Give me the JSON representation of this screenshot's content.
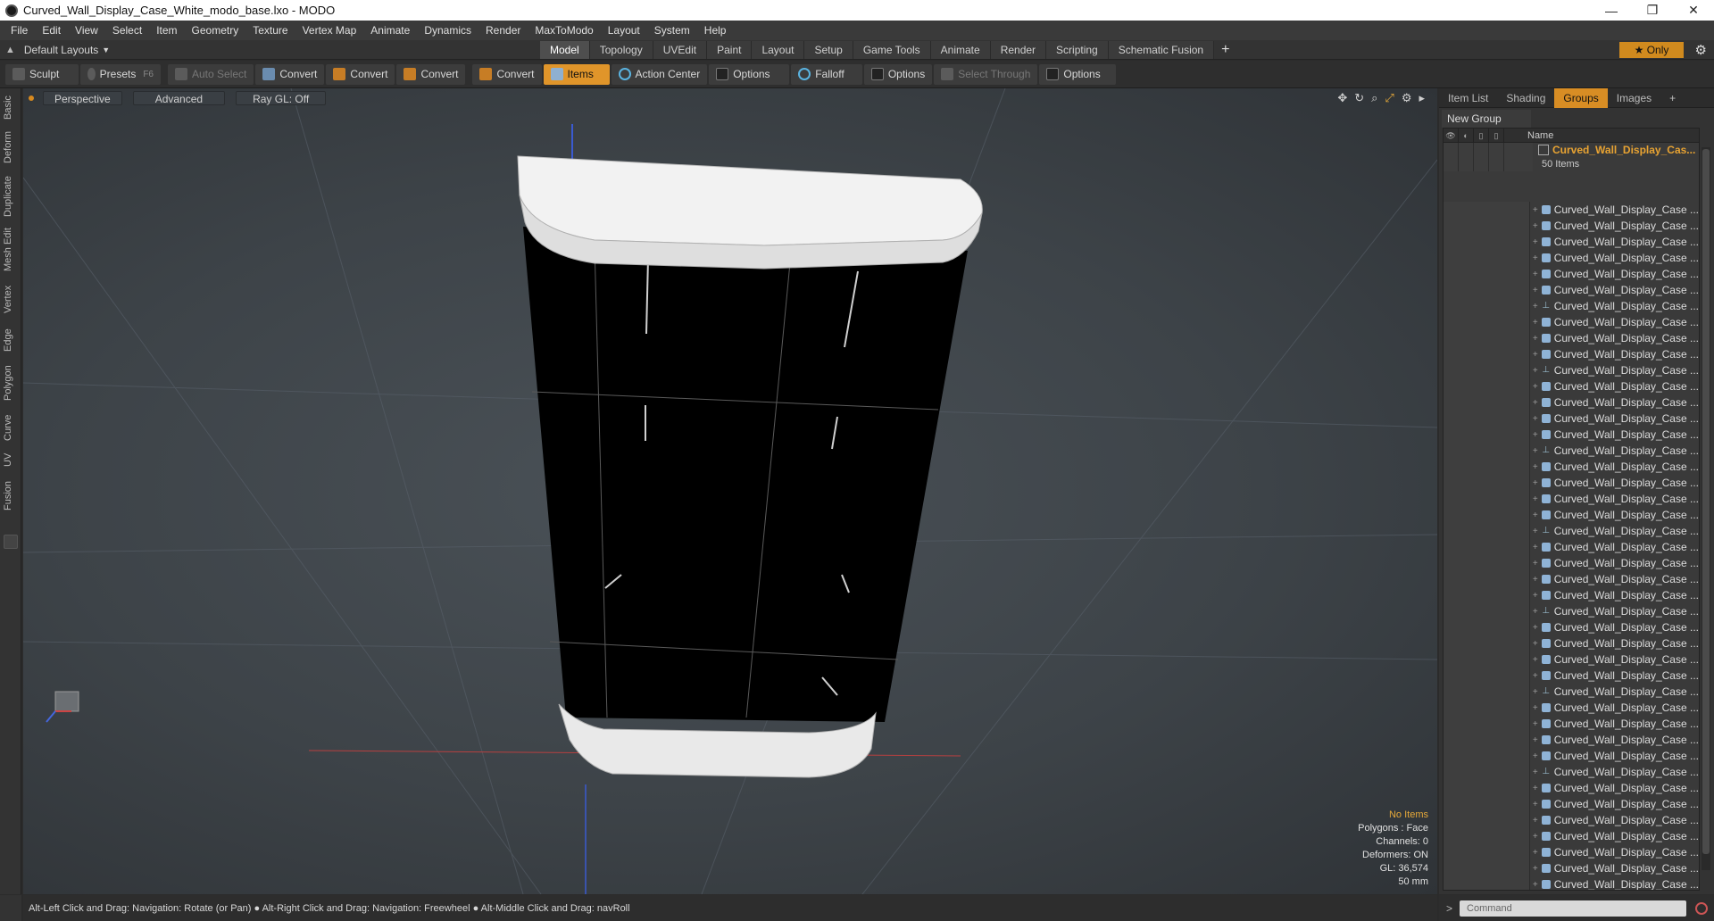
{
  "window": {
    "title": "Curved_Wall_Display_Case_White_modo_base.lxo - MODO",
    "minimize": "—",
    "maximize": "❐",
    "close": "✕"
  },
  "menu": [
    "File",
    "Edit",
    "View",
    "Select",
    "Item",
    "Geometry",
    "Texture",
    "Vertex Map",
    "Animate",
    "Dynamics",
    "Render",
    "MaxToModo",
    "Layout",
    "System",
    "Help"
  ],
  "layout": {
    "name": "Default Layouts",
    "tabs": [
      "Model",
      "Topology",
      "UVEdit",
      "Paint",
      "Layout",
      "Setup",
      "Game Tools",
      "Animate",
      "Render",
      "Scripting",
      "Schematic Fusion"
    ],
    "active_tab": "Model",
    "add": "+",
    "only_label": "★  Only"
  },
  "toolbar": {
    "sculpt": "Sculpt",
    "presets": "Presets",
    "presets_key": "F6",
    "auto_select": "Auto Select",
    "convert1": "Convert",
    "convert2": "Convert",
    "convert3": "Convert",
    "convert4": "Convert",
    "items": "Items",
    "action_center": "Action Center",
    "options1": "Options",
    "falloff": "Falloff",
    "options2": "Options",
    "select_through": "Select Through",
    "options3": "Options"
  },
  "left_tabs": [
    "Basic",
    "Deform",
    "Duplicate",
    "Mesh Edit",
    "Vertex",
    "Edge",
    "Polygon",
    "Curve",
    "UV",
    "Fusion"
  ],
  "viewport": {
    "view": "Perspective",
    "shading": "Advanced",
    "raygl": "Ray GL: Off",
    "info": {
      "selection": "No Items",
      "polygons": "Polygons : Face",
      "channels": "Channels: 0",
      "deformers": "Deformers: ON",
      "gl": "GL: 36,574",
      "unit": "50 mm"
    }
  },
  "right_panel": {
    "tabs": [
      "Item List",
      "Shading",
      "Groups",
      "Images"
    ],
    "active_tab": "Groups",
    "add_tab": "+",
    "new_group": "New Group",
    "col_name": "Name",
    "group_name": "Curved_Wall_Display_Cas...",
    "group_count": "50 Items",
    "items": [
      {
        "name": "Curved_Wall_Display_Case ...",
        "icon": "mesh"
      },
      {
        "name": "Curved_Wall_Display_Case ...",
        "icon": "mesh"
      },
      {
        "name": "Curved_Wall_Display_Case ...",
        "icon": "mesh"
      },
      {
        "name": "Curved_Wall_Display_Case ...",
        "icon": "mesh"
      },
      {
        "name": "Curved_Wall_Display_Case ...",
        "icon": "mesh"
      },
      {
        "name": "Curved_Wall_Display_Case ...",
        "icon": "mesh"
      },
      {
        "name": "Curved_Wall_Display_Case ...",
        "icon": "locator"
      },
      {
        "name": "Curved_Wall_Display_Case ...",
        "icon": "mesh"
      },
      {
        "name": "Curved_Wall_Display_Case ...",
        "icon": "mesh"
      },
      {
        "name": "Curved_Wall_Display_Case ...",
        "icon": "mesh"
      },
      {
        "name": "Curved_Wall_Display_Case ...",
        "icon": "locator"
      },
      {
        "name": "Curved_Wall_Display_Case ...",
        "icon": "mesh"
      },
      {
        "name": "Curved_Wall_Display_Case ...",
        "icon": "mesh"
      },
      {
        "name": "Curved_Wall_Display_Case ...",
        "icon": "mesh"
      },
      {
        "name": "Curved_Wall_Display_Case ...",
        "icon": "mesh"
      },
      {
        "name": "Curved_Wall_Display_Case ...",
        "icon": "locator"
      },
      {
        "name": "Curved_Wall_Display_Case ...",
        "icon": "mesh"
      },
      {
        "name": "Curved_Wall_Display_Case ...",
        "icon": "mesh"
      },
      {
        "name": "Curved_Wall_Display_Case ...",
        "icon": "mesh"
      },
      {
        "name": "Curved_Wall_Display_Case ...",
        "icon": "mesh"
      },
      {
        "name": "Curved_Wall_Display_Case ...",
        "icon": "locator"
      },
      {
        "name": "Curved_Wall_Display_Case ...",
        "icon": "mesh"
      },
      {
        "name": "Curved_Wall_Display_Case ...",
        "icon": "mesh"
      },
      {
        "name": "Curved_Wall_Display_Case ...",
        "icon": "mesh"
      },
      {
        "name": "Curved_Wall_Display_Case ...",
        "icon": "mesh"
      },
      {
        "name": "Curved_Wall_Display_Case ...",
        "icon": "locator"
      },
      {
        "name": "Curved_Wall_Display_Case ...",
        "icon": "mesh"
      },
      {
        "name": "Curved_Wall_Display_Case ...",
        "icon": "mesh"
      },
      {
        "name": "Curved_Wall_Display_Case ...",
        "icon": "mesh"
      },
      {
        "name": "Curved_Wall_Display_Case ...",
        "icon": "mesh"
      },
      {
        "name": "Curved_Wall_Display_Case ...",
        "icon": "locator"
      },
      {
        "name": "Curved_Wall_Display_Case ...",
        "icon": "mesh"
      },
      {
        "name": "Curved_Wall_Display_Case ...",
        "icon": "mesh"
      },
      {
        "name": "Curved_Wall_Display_Case ...",
        "icon": "mesh"
      },
      {
        "name": "Curved_Wall_Display_Case ...",
        "icon": "mesh"
      },
      {
        "name": "Curved_Wall_Display_Case ...",
        "icon": "locator"
      },
      {
        "name": "Curved_Wall_Display_Case ...",
        "icon": "mesh"
      },
      {
        "name": "Curved_Wall_Display_Case ...",
        "icon": "mesh"
      },
      {
        "name": "Curved_Wall_Display_Case ...",
        "icon": "mesh"
      },
      {
        "name": "Curved_Wall_Display_Case ...",
        "icon": "mesh"
      },
      {
        "name": "Curved_Wall_Display_Case ...",
        "icon": "mesh"
      },
      {
        "name": "Curved_Wall_Display_Case ...",
        "icon": "mesh"
      },
      {
        "name": "Curved_Wall_Display_Case ...",
        "icon": "mesh"
      },
      {
        "name": "Curved_Wall_Display_Case ...",
        "icon": "mesh"
      }
    ]
  },
  "status": "Alt-Left Click and Drag: Navigation: Rotate (or Pan) ● Alt-Right Click and Drag: Navigation: Freewheel ● Alt-Middle Click and Drag: navRoll",
  "command": {
    "prompt": ">",
    "placeholder": "Command"
  },
  "colors": {
    "accent": "#e0952a",
    "group_name": "#e8a332",
    "bg": "#2b2b2b"
  }
}
